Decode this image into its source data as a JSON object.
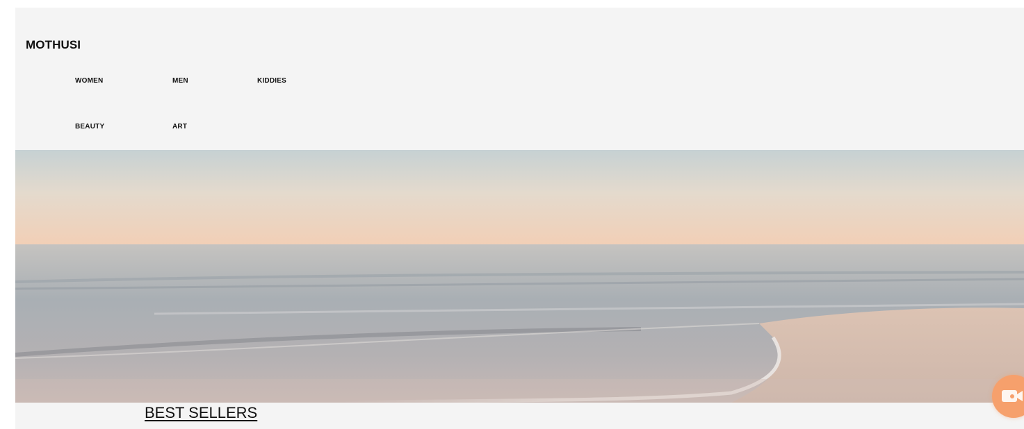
{
  "brand": {
    "name": "MOTHUSI"
  },
  "nav": {
    "items": [
      {
        "label": "WOMEN"
      },
      {
        "label": "MEN"
      },
      {
        "label": "KIDDIES"
      },
      {
        "label": "BEAUTY"
      },
      {
        "label": "ART"
      }
    ]
  },
  "hero": {
    "image": "beach-sunset-photo",
    "colors": {
      "sky_top": "#c9d3d4",
      "sky_horizon": "#f1d0b6",
      "sea": "#a7aeb4",
      "sand": "#d2b9ab"
    }
  },
  "sections": {
    "best_sellers_heading": "BEST SELLERS"
  },
  "chat_widget": {
    "icon": "video-chat-icon",
    "color": "#f6a06c"
  }
}
